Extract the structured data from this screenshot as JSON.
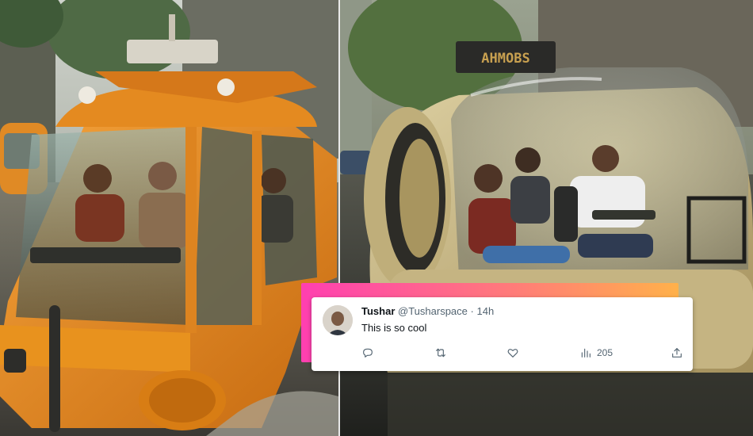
{
  "photos": {
    "left": {
      "alt": "orange amphibious vehicle"
    },
    "right": {
      "alt": "bubble amphibious vehicle",
      "sign_text": "AHMOBS"
    }
  },
  "tweet": {
    "display_name": "Tushar",
    "handle": "@Tusharspace",
    "separator": "·",
    "time": "14h",
    "text": "This is so cool",
    "views": "205",
    "actions": [
      "reply-icon",
      "retweet-icon",
      "like-icon",
      "views-icon",
      "share-icon"
    ]
  },
  "colors": {
    "glow_start": "#ff3fb0",
    "glow_end": "#ffb14a",
    "vehicle_orange": "#e58a1c",
    "vehicle_beige": "#cdbb86"
  }
}
